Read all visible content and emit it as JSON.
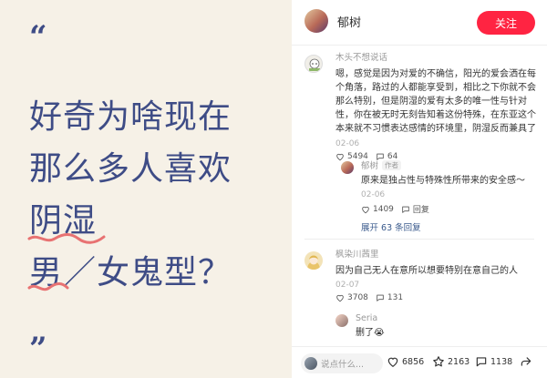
{
  "image": {
    "quote_open": "“",
    "quote_close": "”",
    "headline_lines": [
      "好奇为啥现在",
      "那么多人喜欢",
      "阴湿",
      "男／女鬼型？"
    ]
  },
  "author": {
    "name": "郁树",
    "follow_label": "关注"
  },
  "comments": [
    {
      "user": "木头不想说话",
      "text": "嗯，感觉是因为对爱的不确信，阳光的爱会洒在每个角落，路过的人都能享受到，相比之下你就不会那么特别，但是阴湿的爱有太多的唯一性与针对性，你在被无时无刻告知着这份特殊，在东亚这个本来就不习惯表达感情的环境里，阴湿反而兼具了说不出口与最强的特殊",
      "date": "02-06",
      "likes": "5494",
      "replies_count": "64"
    },
    {
      "user": "郁树",
      "tag": "作者",
      "text": "原来是独占性与特殊性所带来的安全感～",
      "date": "02-06",
      "likes": "1409",
      "replies_label": "回复"
    },
    {
      "expand_label": "展开 63 条回复"
    },
    {
      "user": "枫染川茜里",
      "text": "因为自己无人在意所以想要特别在意自己的人",
      "date": "02-07",
      "likes": "3708",
      "replies_count": "131"
    },
    {
      "user": "Seria",
      "text": "删了😭"
    }
  ],
  "bottom_bar": {
    "input_placeholder": "说点什么...",
    "likes": "6856",
    "stars": "2163",
    "comments": "1138"
  },
  "colors": {
    "accent": "#ff2442",
    "headline": "#3e4c86",
    "squiggle": "#e87272",
    "card_bg": "#f6f1e7"
  }
}
